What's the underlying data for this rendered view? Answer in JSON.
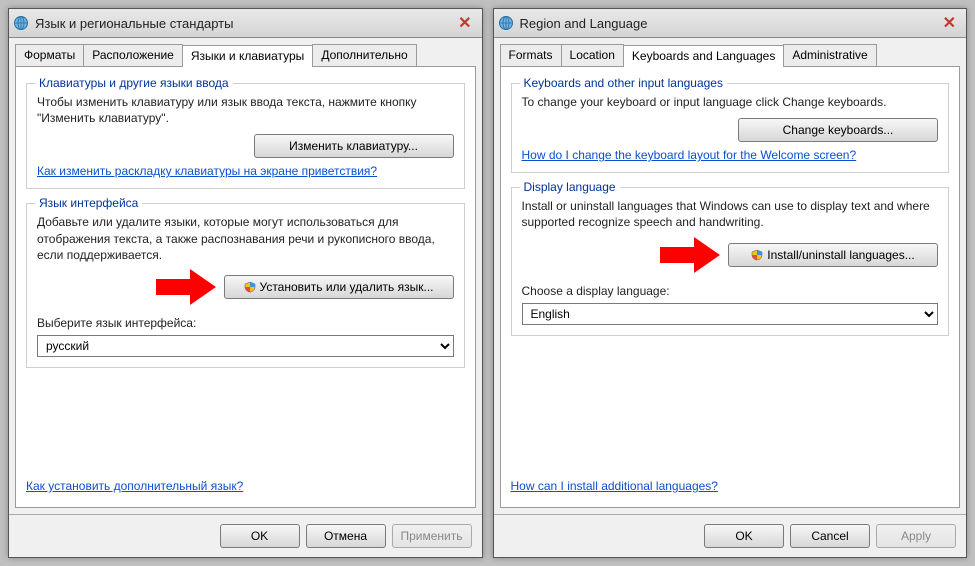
{
  "left": {
    "title": "Язык и региональные стандарты",
    "tabs": {
      "formats": "Форматы",
      "location": "Расположение",
      "keyboards": "Языки и клавиатуры",
      "admin": "Дополнительно"
    },
    "group1": {
      "legend": "Клавиатуры и другие языки ввода",
      "text": "Чтобы изменить клавиатуру или язык ввода текста, нажмите кнопку \"Изменить клавиатуру\".",
      "button": "Изменить клавиатуру...",
      "link": "Как изменить раскладку клавиатуры на экране приветствия?"
    },
    "group2": {
      "legend": "Язык интерфейса",
      "text": "Добавьте или удалите языки, которые могут использоваться для отображения текста, а также распознавания речи и рукописного ввода, если                          поддерживается.",
      "button": "Установить или удалить язык...",
      "choose_label": "Выберите язык интерфейса:",
      "select_value": "русский"
    },
    "bottom_link": "Как установить дополнительный язык?",
    "ok": "OK",
    "cancel": "Отмена",
    "apply": "Применить"
  },
  "right": {
    "title": "Region and Language",
    "tabs": {
      "formats": "Formats",
      "location": "Location",
      "keyboards": "Keyboards and Languages",
      "admin": "Administrative"
    },
    "group1": {
      "legend": "Keyboards and other input languages",
      "text": "To change your keyboard or input language click Change keyboards.",
      "button": "Change keyboards...",
      "link": "How do I change the keyboard layout for the Welcome screen?"
    },
    "group2": {
      "legend": "Display language",
      "text": "Install or uninstall languages that Windows can use to display text and where supported recognize speech and handwriting.",
      "button": "Install/uninstall languages...",
      "choose_label": "Choose a display language:",
      "select_value": "English"
    },
    "bottom_link": "How can I install additional languages?",
    "ok": "OK",
    "cancel": "Cancel",
    "apply": "Apply"
  }
}
